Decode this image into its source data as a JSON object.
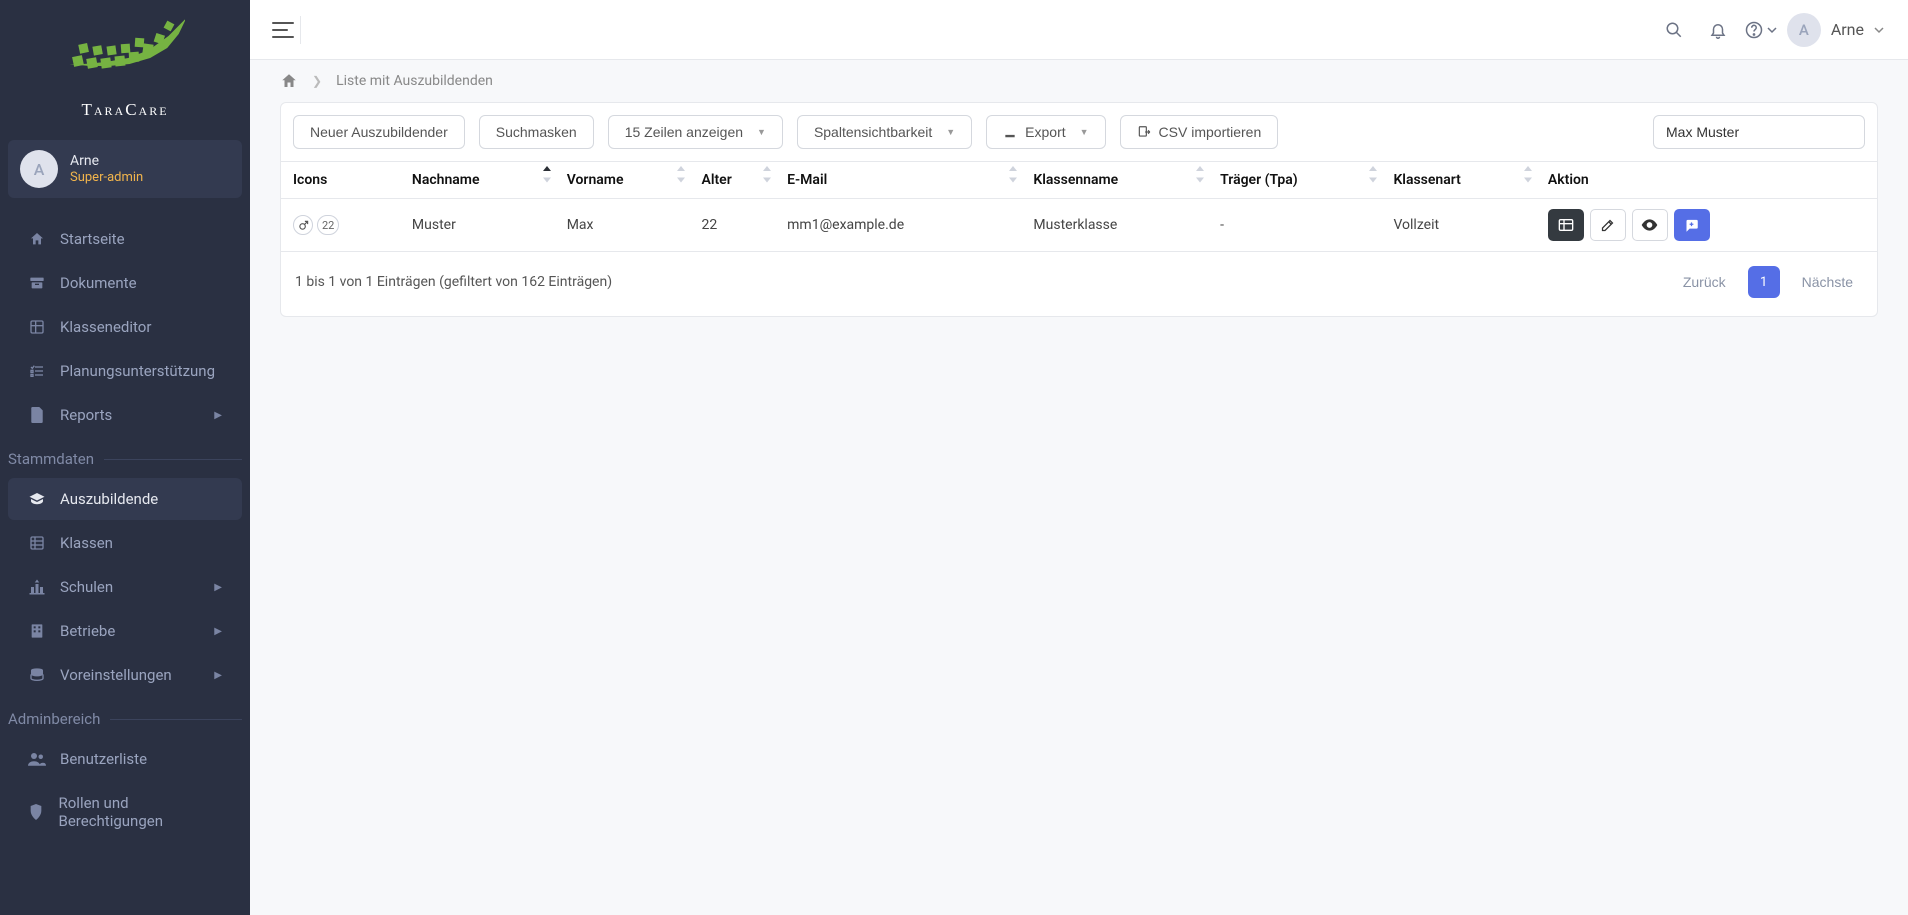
{
  "brand": {
    "name": "TaraCare"
  },
  "user": {
    "initial": "A",
    "name": "Arne",
    "role": "Super-admin"
  },
  "sidebar": {
    "items": [
      {
        "label": "Startseite",
        "icon": "home"
      },
      {
        "label": "Dokumente",
        "icon": "archive"
      },
      {
        "label": "Klasseneditor",
        "icon": "grid"
      },
      {
        "label": "Planungsunterstützung",
        "icon": "tasks"
      },
      {
        "label": "Reports",
        "icon": "file",
        "caret": true
      }
    ],
    "section1": "Stammdaten",
    "stamm": [
      {
        "label": "Auszubildende",
        "icon": "grad",
        "active": true
      },
      {
        "label": "Klassen",
        "icon": "rows"
      },
      {
        "label": "Schulen",
        "icon": "school",
        "caret": true
      },
      {
        "label": "Betriebe",
        "icon": "building",
        "caret": true
      },
      {
        "label": "Voreinstellungen",
        "icon": "db",
        "caret": true
      }
    ],
    "section2": "Adminbereich",
    "admin": [
      {
        "label": "Benutzerliste",
        "icon": "users"
      },
      {
        "label": "Rollen und Berechtigungen",
        "icon": "shield"
      }
    ]
  },
  "topbar": {
    "username": "Arne",
    "userInitial": "A"
  },
  "breadcrumb": {
    "title": "Liste mit Auszubildenden"
  },
  "toolbar": {
    "new": "Neuer Auszubildender",
    "masks": "Suchmasken",
    "rows": "15 Zeilen anzeigen",
    "cols": "Spaltensichtbarkeit",
    "export": "Export",
    "import": "CSV importieren",
    "searchValue": "Max Muster"
  },
  "columns": {
    "icons": "Icons",
    "nachname": "Nachname",
    "vorname": "Vorname",
    "alter": "Alter",
    "email": "E-Mail",
    "klasse": "Klassenname",
    "traeger": "Träger (Tpa)",
    "art": "Klassenart",
    "aktion": "Aktion"
  },
  "row": {
    "age_icon": "22",
    "nachname": "Muster",
    "vorname": "Max",
    "alter": "22",
    "email": "mm1@example.de",
    "klasse": "Musterklasse",
    "traeger": "-",
    "art": "Vollzeit"
  },
  "footer": {
    "info": "1 bis 1 von 1 Einträgen (gefiltert von 162 Einträgen)",
    "prev": "Zurück",
    "page": "1",
    "next": "Nächste"
  }
}
